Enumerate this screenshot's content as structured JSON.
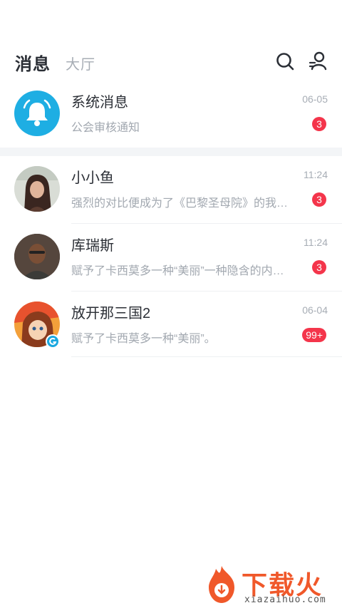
{
  "header": {
    "tab_active": "消息",
    "tab_inactive": "大厅",
    "search_icon": "search-icon",
    "contacts_icon": "contacts-icon"
  },
  "messages": [
    {
      "title": "系统消息",
      "preview": "公会审核通知",
      "time": "06-05",
      "badge": "3",
      "avatar": "bell-icon"
    },
    {
      "title": "小小鱼",
      "preview": "强烈的对比便成为了《巴黎圣母院》的我…",
      "time": "11:24",
      "badge": "3",
      "avatar": "user-photo"
    },
    {
      "title": "库瑞斯",
      "preview": "赋予了卡西莫多一种“美丽”一种隐含的内…",
      "time": "11:24",
      "badge": "3",
      "avatar": "user-photo"
    },
    {
      "title": "放开那三国2",
      "preview": "赋予了卡西莫多一种“美丽”。",
      "time": "06-04",
      "badge": "99+",
      "avatar": "game-avatar"
    }
  ],
  "watermark": {
    "text": "下载火",
    "sub": "xiazaihuo.com"
  },
  "colors": {
    "accent_blue": "#1eaee3",
    "badge_red": "#f4354b",
    "watermark_orange": "#f0582a"
  }
}
